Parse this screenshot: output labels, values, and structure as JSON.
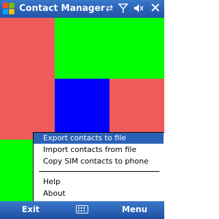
{
  "title_bar": {
    "title": "Contact Manager",
    "icons": [
      "start-flag-icon",
      "connectivity-icon",
      "signal-icon",
      "volume-icon",
      "close-icon"
    ]
  },
  "colors": {
    "red": "#ef5b5b",
    "green": "#00ff00",
    "blue": "#0000ff",
    "menu_highlight": "#2a62b8"
  },
  "menu": {
    "items": [
      {
        "label": "Export contacts to file",
        "selected": true
      },
      {
        "label": "Import contacts from file",
        "selected": false
      },
      {
        "label": "Copy SIM contacts to phone",
        "selected": false
      },
      {
        "label": "Help",
        "selected": false
      },
      {
        "label": "About",
        "selected": false
      }
    ]
  },
  "softkeys": {
    "left": "Exit",
    "right": "Menu",
    "center_icon": "keyboard-icon"
  }
}
